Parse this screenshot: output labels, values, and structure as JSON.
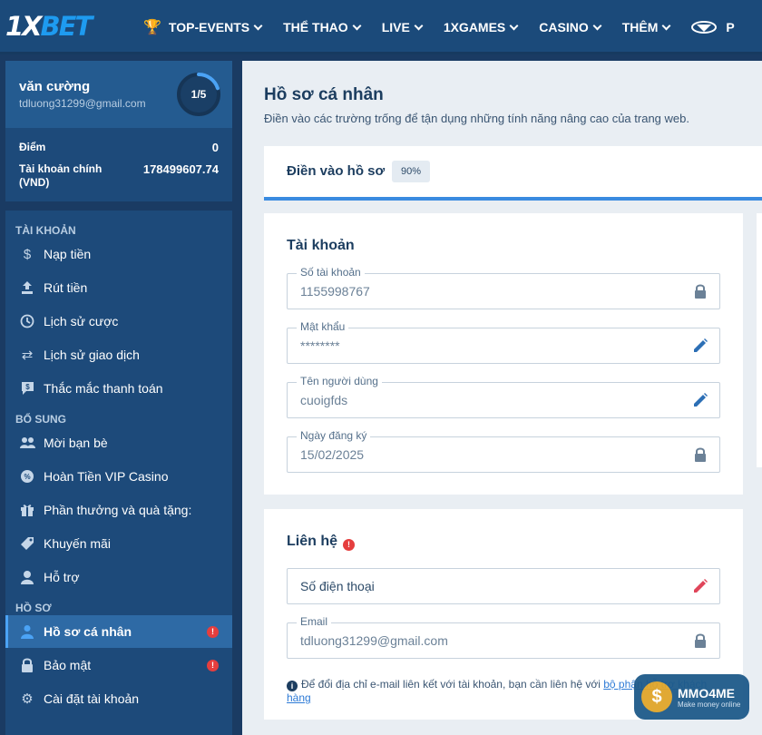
{
  "header": {
    "logo": "1XBET",
    "nav": [
      {
        "label": "TOP-EVENTS",
        "icon": "trophy-icon"
      },
      {
        "label": "THỂ THAO"
      },
      {
        "label": "LIVE"
      },
      {
        "label": "1XGAMES"
      },
      {
        "label": "CASINO"
      },
      {
        "label": "THÊM"
      },
      {
        "label": "P",
        "icon": "promo-icon"
      }
    ]
  },
  "profile": {
    "name": "văn cường",
    "email": "tdluong31299@gmail.com",
    "progress": "1/5",
    "progress_fraction": 0.2,
    "points_label": "Điểm",
    "points_value": "0",
    "balance_label": "Tài khoản chính (VND)",
    "balance_value": "178499607.74"
  },
  "menu": {
    "section_account": "TÀI KHOẢN",
    "section_extra": "BỔ SUNG",
    "section_profile": "HỒ SƠ",
    "items": [
      {
        "label": "Nạp tiền",
        "icon": "dollar-icon"
      },
      {
        "label": "Rút tiền",
        "icon": "upload-icon"
      },
      {
        "label": "Lịch sử cược",
        "icon": "clock-icon"
      },
      {
        "label": "Lịch sử giao dịch",
        "icon": "transfer-icon"
      },
      {
        "label": "Thắc mắc thanh toán",
        "icon": "payment-chat-icon"
      },
      {
        "label": "Mời bạn bè",
        "icon": "friends-icon"
      },
      {
        "label": "Hoàn Tiền VIP Casino",
        "icon": "cashback-icon"
      },
      {
        "label": "Phần thưởng và quà tặng:",
        "icon": "gift-icon"
      },
      {
        "label": "Khuyến mãi",
        "icon": "tag-icon"
      },
      {
        "label": "Hỗ trợ",
        "icon": "support-icon"
      },
      {
        "label": "Hồ sơ cá nhân",
        "icon": "user-icon"
      },
      {
        "label": "Bảo mật",
        "icon": "lock-icon"
      },
      {
        "label": "Cài đặt tài khoản",
        "icon": "gear-icon"
      }
    ],
    "warn_mark": "!"
  },
  "main": {
    "title": "Hồ sơ cá nhân",
    "description": "Điền vào các trường trống để tận dụng những tính năng nâng cao của trang web.",
    "fill_label": "Điền vào hồ sơ",
    "fill_percent": "90%",
    "account_card": {
      "title": "Tài khoản",
      "fields": [
        {
          "label": "Số tài khoản",
          "value": "1155998767",
          "icon": "lock-icon"
        },
        {
          "label": "Mật khẩu",
          "value": "********",
          "icon": "edit-icon"
        },
        {
          "label": "Tên người dùng",
          "value": "cuoigfds",
          "icon": "edit-icon"
        },
        {
          "label": "Ngày đăng ký",
          "value": "15/02/2025",
          "icon": "lock-icon"
        }
      ]
    },
    "contact_card": {
      "title": "Liên hệ",
      "warn_mark": "!",
      "phone_placeholder": "Số điện thoại",
      "email_label": "Email",
      "email_value": "tdluong31299@gmail.com",
      "note_text": "Để đổi địa chỉ e-mail liên kết với tài khoản, bạn cần liên hệ với ",
      "note_link": "bộ phận hỗ trợ khách hàng"
    }
  },
  "watermark": {
    "title": "MMO4ME",
    "subtitle": "Make money online",
    "coin": "$"
  }
}
